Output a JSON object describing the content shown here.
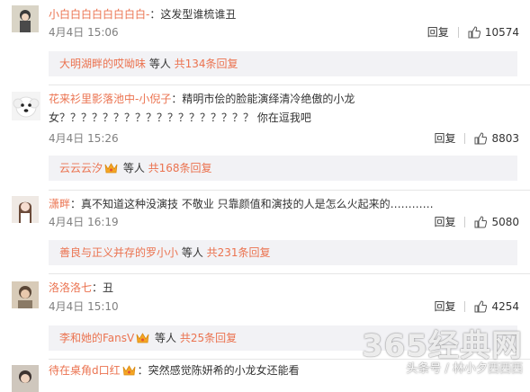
{
  "colors": {
    "username": "#eb7350",
    "meta": "#808080",
    "subbox_bg": "#f2f2f5"
  },
  "comments": [
    {
      "avatar": "avatar-icon",
      "username": "小白白白白白白白白-",
      "text": "：这发型谁梳谁丑",
      "text2": "",
      "time": "4月4日 15:06",
      "reply": "回复",
      "likes": "10574",
      "sub": {
        "name": "大明湖畔的哎呦味",
        "mid": " 等人 ",
        "total": "共134条回复",
        "badge": false
      }
    },
    {
      "avatar": "dog-avatar-icon",
      "username": "花来衫里影落池中-小倪子",
      "text": "：精明市侩的脸能演绎清冷绝傲的小龙",
      "text2": "女？？？？？？？？？？？？？？？？？？ 你在逗我吧",
      "time": "4月4日 15:26",
      "reply": "回复",
      "likes": "8803",
      "sub": {
        "name": "云云云汐",
        "mid": " 等人 ",
        "total": "共168条回复",
        "badge": true
      }
    },
    {
      "avatar": "girl-avatar-icon",
      "username": "潇畔",
      "text": "：真不知道这种没演技 不敬业 只靠颜值和演技的人是怎么火起来的…………",
      "text2": "",
      "time": "4月4日 16:19",
      "reply": "回复",
      "likes": "5080",
      "sub": {
        "name": "善良与正义并存的罗小小",
        "mid": " 等人 ",
        "total": "共231条回复",
        "badge": false
      }
    },
    {
      "avatar": "person-avatar-icon",
      "username": "洛洛洛七",
      "text": "：丑",
      "text2": "",
      "time": "4月4日 15:10",
      "reply": "回复",
      "likes": "4254",
      "sub": {
        "name": "李和她的FansV",
        "mid": " 等人 ",
        "total": "共25条回复",
        "badge": true
      }
    },
    {
      "avatar": "avatar-icon",
      "username": "待在桌角d口红",
      "text": "：突然感觉陈妍希的小龙女还能看",
      "text2": "",
      "badge": true
    }
  ],
  "watermark": {
    "logo": "365经典网",
    "sub": "头条号 / 林小夕西西西"
  }
}
